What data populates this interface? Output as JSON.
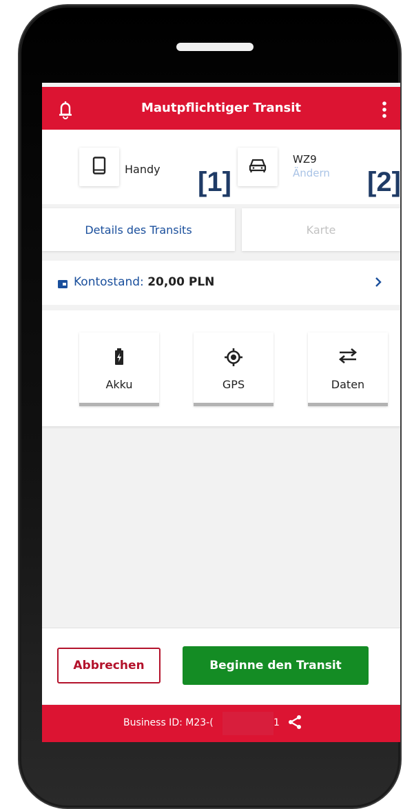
{
  "header": {
    "title": "Mautpflichtiger Transit",
    "bell_icon": "bell-icon",
    "menu_icon": "kebab-menu-icon",
    "color": "#dc1432"
  },
  "device": {
    "icon": "phone-icon",
    "label": "Handy",
    "marker": "[1]"
  },
  "vehicle": {
    "icon": "car-icon",
    "plate": "WZ9",
    "change_label": "Ändern",
    "marker": "[2]"
  },
  "tabs": [
    {
      "label": "Details des Transits",
      "active": true
    },
    {
      "label": "Karte",
      "active": false
    }
  ],
  "balance": {
    "icon": "wallet-icon",
    "label": "Kontostand:",
    "amount": "20,00 PLN"
  },
  "status": [
    {
      "icon": "battery-icon",
      "label": "Akku"
    },
    {
      "icon": "gps-icon",
      "label": "GPS"
    },
    {
      "icon": "data-transfer-icon",
      "label": "Daten"
    }
  ],
  "actions": {
    "cancel_label": "Abbrechen",
    "start_label": "Beginne den Transit",
    "start_color": "#148c24"
  },
  "footer": {
    "business_label": "Business ID:  M23-(",
    "business_suffix": "1",
    "share_icon": "share-icon"
  }
}
